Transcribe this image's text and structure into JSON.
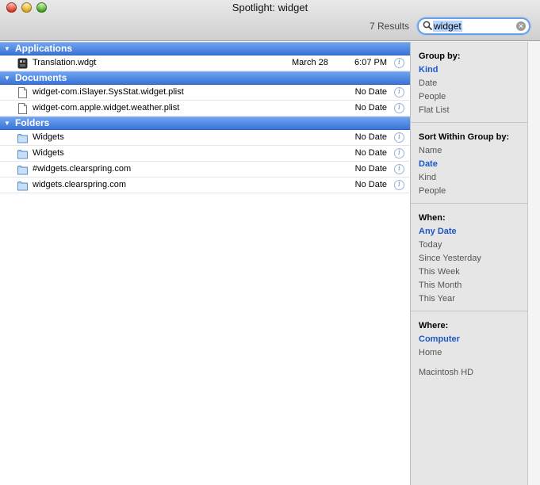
{
  "window": {
    "title": "Spotlight: widget",
    "results_count": "7 Results"
  },
  "search": {
    "query": "widget",
    "clear_glyph": "✕"
  },
  "groups": [
    {
      "label": "Applications",
      "rows": [
        {
          "name": "Translation.wdgt",
          "date": "March 28",
          "time": "6:07 PM",
          "icon": "widget-app-icon"
        }
      ]
    },
    {
      "label": "Documents",
      "rows": [
        {
          "name": "widget-com.iSlayer.SysStat.widget.plist",
          "date": "",
          "time": "No Date",
          "icon": "document-icon"
        },
        {
          "name": "widget-com.apple.widget.weather.plist",
          "date": "",
          "time": "No Date",
          "icon": "document-icon"
        }
      ]
    },
    {
      "label": "Folders",
      "rows": [
        {
          "name": "Widgets",
          "date": "",
          "time": "No Date",
          "icon": "folder-icon"
        },
        {
          "name": "Widgets",
          "date": "",
          "time": "No Date",
          "icon": "folder-icon"
        },
        {
          "name": "#widgets.clearspring.com",
          "date": "",
          "time": "No Date",
          "icon": "folder-icon"
        },
        {
          "name": "widgets.clearspring.com",
          "date": "",
          "time": "No Date",
          "icon": "folder-icon"
        }
      ]
    }
  ],
  "info_glyph": "i",
  "sidebar": {
    "group_by": {
      "heading": "Group by:",
      "items": [
        "Kind",
        "Date",
        "People",
        "Flat List"
      ],
      "selected": "Kind"
    },
    "sort_within": {
      "heading": "Sort Within Group by:",
      "items": [
        "Name",
        "Date",
        "Kind",
        "People"
      ],
      "selected": "Date"
    },
    "when": {
      "heading": "When:",
      "items": [
        "Any Date",
        "Today",
        "Since Yesterday",
        "This Week",
        "This Month",
        "This Year"
      ],
      "selected": "Any Date"
    },
    "where": {
      "heading": "Where:",
      "items": [
        "Computer",
        "Home"
      ],
      "selected": "Computer",
      "extra": "Macintosh HD"
    }
  },
  "colors": {
    "group_header": "#3a74d8",
    "selected_filter": "#1d56c7",
    "search_focus": "#6aa0e8"
  }
}
